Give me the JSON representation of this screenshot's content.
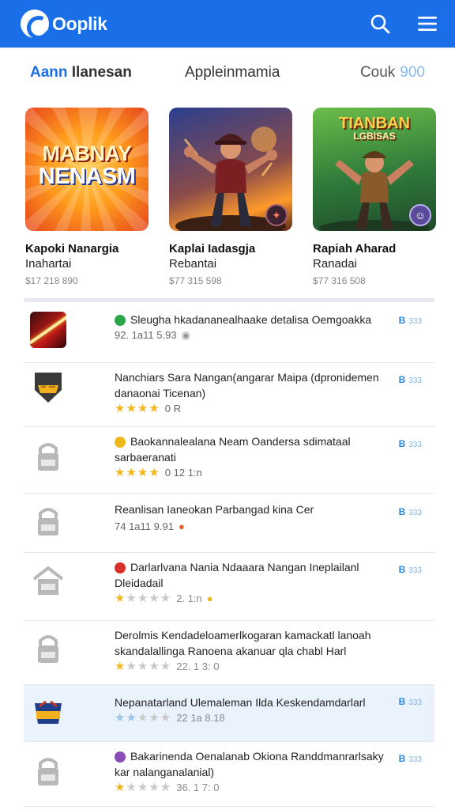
{
  "app": {
    "name": "Ooplik"
  },
  "tabs": [
    {
      "accent": "Aann",
      "rest": " Ilanesan"
    },
    {
      "label": "Appleinmamia"
    },
    {
      "label": "Couk",
      "count": "900"
    }
  ],
  "featured": [
    {
      "art_text_1": "MABNAY",
      "art_text_2": "NENASM",
      "title": "Kapoki Nanargia",
      "subtitle": "Inahartai",
      "meta": "$17 218 890"
    },
    {
      "title": "Kaplai Iadasgja",
      "subtitle": "Rebantai",
      "meta": "$77 315 598"
    },
    {
      "art_text_1": "TIANBAN",
      "art_text_2": "LGBISAS",
      "title": "Rapiah Aharad",
      "subtitle": "Ranadai",
      "meta": "$77 316 508"
    }
  ],
  "list": [
    {
      "title": "Sleugha hkadananealhaake detalisa Oemgoakka",
      "meta": "92. 1a11 5.93",
      "rating": null,
      "icon": "game-red-icon",
      "action": "B",
      "action_sub": "333"
    },
    {
      "title": "Nanchiars Sara Nangan(angarar Maipa (dpronidemen danaonai Ticenan)",
      "meta": "0 R",
      "rating": 4,
      "icon": "game-shield-icon",
      "action": "B",
      "action_sub": "333"
    },
    {
      "title": "Baokannalealana Neam Oandersa sdimataal sarbaeranati",
      "meta": "0 12 1:n",
      "rating": 4,
      "icon": "lock-placeholder-icon",
      "action": "B",
      "action_sub": "333"
    },
    {
      "title": "Reanlisan Ianeokan Parbangad kina Cer",
      "meta": "74 1a11 9.91",
      "rating": null,
      "icon": "lock-placeholder-icon",
      "action": "B",
      "action_sub": "333"
    },
    {
      "title": "Darlarlvana Nania Ndaaara Nangan Ineplailanl Dleidadail",
      "meta": "2. 1:n",
      "rating": 1,
      "icon": "home-placeholder-icon",
      "action": "B",
      "action_sub": "333"
    },
    {
      "title": "Derolmis Kendadeloamerlkogaran kamackatl lanoah skandalallinga Ranoena akanuar qla chabl Harl",
      "meta": "22. 1 3: 0",
      "rating": 1,
      "icon": "lock-placeholder-icon",
      "action": "",
      "action_sub": ""
    },
    {
      "title": "Nepanatarland Ulemaleman Ilda Keskendamdarlarl",
      "meta": "22 1a 8.18",
      "rating": 2,
      "icon": "game-emblem-icon",
      "action": "B",
      "action_sub": "333"
    },
    {
      "title": "Bakarinenda Oenalanab Okiona Randdmanrarlsaky kar nalanganalanial)",
      "meta": "36. 1 7: 0",
      "rating": 1,
      "icon": "lock-placeholder-icon",
      "action": "B",
      "action_sub": "333"
    }
  ],
  "colors": {
    "brand": "#1a6ee8",
    "star": "#f0b71a",
    "selected_bg": "#eaf3fd"
  }
}
